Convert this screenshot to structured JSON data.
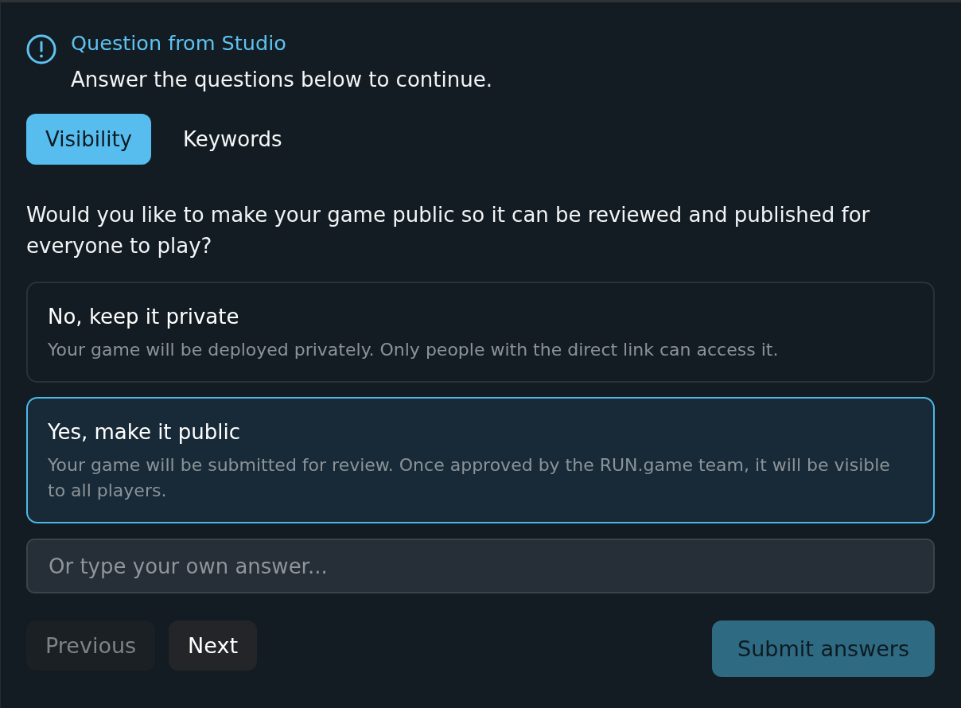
{
  "header": {
    "title": "Question from Studio",
    "subtitle": "Answer the questions below to continue."
  },
  "tabs": [
    {
      "label": "Visibility",
      "selected": true
    },
    {
      "label": "Keywords",
      "selected": false
    }
  ],
  "question": "Would you like to make your game public so it can be reviewed and published for everyone to play?",
  "options": [
    {
      "title": "No, keep it private",
      "description": "Your game will be deployed privately. Only people with the direct link can access it.",
      "selected": false
    },
    {
      "title": "Yes, make it public",
      "description": "Your game will be submitted for review. Once approved by the RUN.game team, it will be visible to all players.",
      "selected": true
    }
  ],
  "custom_answer": {
    "placeholder": "Or type your own answer..."
  },
  "nav_buttons": [
    {
      "label": "Previous",
      "disabled": true
    },
    {
      "label": "Next",
      "disabled": false
    }
  ],
  "submit_button": {
    "label": "Submit answers"
  }
}
